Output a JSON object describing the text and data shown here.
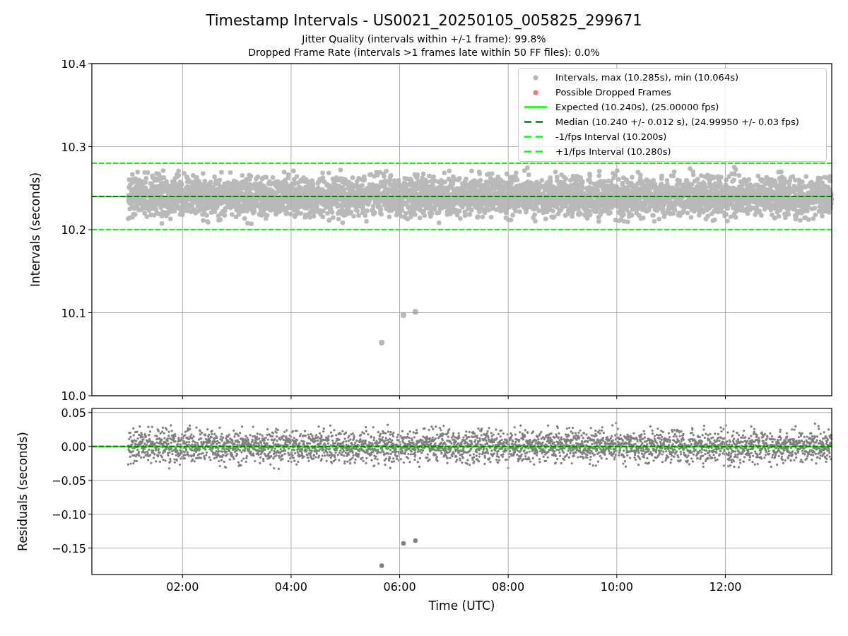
{
  "figure": {
    "title": "Timestamp Intervals - US0021_20250105_005825_299671",
    "subtitles": [
      "Jitter Quality (intervals within +/-1 frame): 99.8%",
      "Dropped Frame Rate (intervals >1 frames late within 50 FF files): 0.0%"
    ]
  },
  "panels": [
    {
      "chart_data": {
        "type": "scatter",
        "ylabel": "Intervals (seconds)",
        "xlim": [
          0.33,
          13.96
        ],
        "ylim": [
          10.0,
          10.4
        ],
        "grid": true,
        "yticks": [
          {
            "value": 10.0,
            "label": "10.0"
          },
          {
            "value": 10.1,
            "label": "10.1"
          },
          {
            "value": 10.2,
            "label": "10.2"
          },
          {
            "value": 10.3,
            "label": "10.3"
          },
          {
            "value": 10.4,
            "label": "10.4"
          }
        ],
        "series": [
          {
            "name": "Intervals, max (10.285s), min (10.064s)",
            "color": "#808080",
            "x": [
              5.67,
              6.07,
              6.29
            ],
            "values": [
              10.064,
              10.097,
              10.101
            ]
          },
          {
            "name": "Possible Dropped Frames",
            "color": "#ff0000"
          }
        ],
        "ref_lines": [
          {
            "axis": "y",
            "value": 10.24,
            "label": "Expected (10.240s), (25.00000 fps)",
            "color": "#00ff00"
          },
          {
            "axis": "y",
            "value": 10.24,
            "label": "Median (10.240 +/- 0.012 s), (24.99950 +/- 0.03 fps)",
            "color": "#008000"
          },
          {
            "axis": "y",
            "value": 10.2,
            "label": "-1/fps Interval (10.200s)",
            "color": "#00ff00"
          },
          {
            "axis": "y",
            "value": 10.28,
            "label": "+1/fps Interval (10.280s)",
            "color": "#00ff00"
          }
        ]
      }
    },
    {
      "chart_data": {
        "type": "scatter",
        "xlabel": "Time (UTC)",
        "ylabel": "Residuals (seconds)",
        "xlim": [
          0.33,
          13.96
        ],
        "ylim": [
          -0.189,
          0.056
        ],
        "grid": true,
        "xticks": [
          {
            "value": 2,
            "label": "02:00"
          },
          {
            "value": 4,
            "label": "04:00"
          },
          {
            "value": 6,
            "label": "06:00"
          },
          {
            "value": 8,
            "label": "08:00"
          },
          {
            "value": 10,
            "label": "10:00"
          },
          {
            "value": 12,
            "label": "12:00"
          }
        ],
        "yticks": [
          {
            "value": 0.05,
            "label": "0.05"
          },
          {
            "value": 0,
            "label": "0.00"
          },
          {
            "value": -0.05,
            "label": "−0.05"
          },
          {
            "value": -0.1,
            "label": "−0.10"
          },
          {
            "value": -0.15,
            "label": "−0.15"
          }
        ],
        "series": [
          {
            "color": "#808080",
            "x": [
              5.67,
              6.07,
              6.29
            ],
            "values": [
              -0.176,
              -0.143,
              -0.139
            ]
          }
        ],
        "ref_lines": [
          {
            "axis": "y",
            "value": 0,
            "color": "#00ff00"
          },
          {
            "axis": "y",
            "value": 0,
            "color": "#008000"
          }
        ]
      }
    }
  ]
}
